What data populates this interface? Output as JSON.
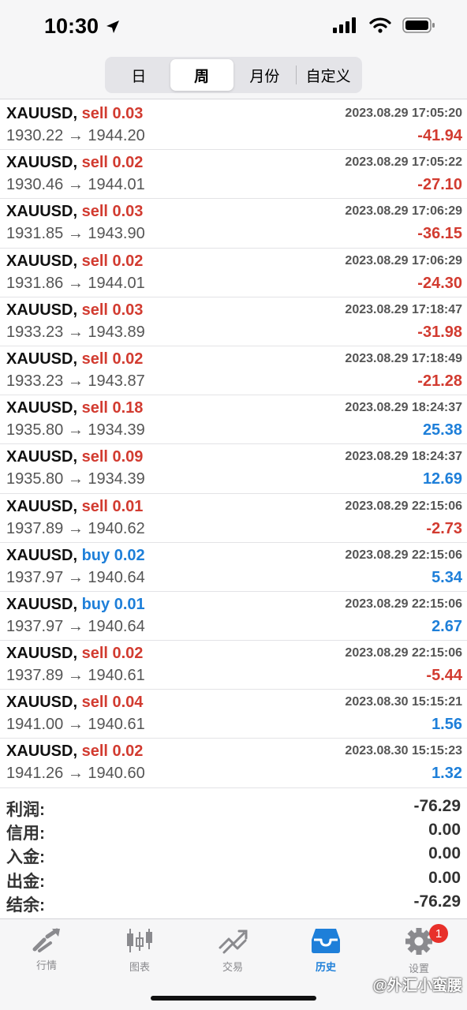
{
  "status_bar": {
    "time": "10:30",
    "icons": [
      "location-arrow-icon",
      "signal-icon",
      "wifi-icon",
      "battery-icon"
    ]
  },
  "segments": [
    {
      "label": "日",
      "active": false
    },
    {
      "label": "周",
      "active": true
    },
    {
      "label": "月份",
      "active": false
    },
    {
      "label": "自定义",
      "active": false
    }
  ],
  "trades": [
    {
      "symbol": "XAUUSD,",
      "side": "sell",
      "volume": "0.03",
      "datetime": "2023.08.29 17:05:20",
      "prices": "1930.22 → 1944.20",
      "profit": "-41.94",
      "sign": "neg"
    },
    {
      "symbol": "XAUUSD,",
      "side": "sell",
      "volume": "0.02",
      "datetime": "2023.08.29 17:05:22",
      "prices": "1930.46 → 1944.01",
      "profit": "-27.10",
      "sign": "neg"
    },
    {
      "symbol": "XAUUSD,",
      "side": "sell",
      "volume": "0.03",
      "datetime": "2023.08.29 17:06:29",
      "prices": "1931.85 → 1943.90",
      "profit": "-36.15",
      "sign": "neg"
    },
    {
      "symbol": "XAUUSD,",
      "side": "sell",
      "volume": "0.02",
      "datetime": "2023.08.29 17:06:29",
      "prices": "1931.86 → 1944.01",
      "profit": "-24.30",
      "sign": "neg"
    },
    {
      "symbol": "XAUUSD,",
      "side": "sell",
      "volume": "0.03",
      "datetime": "2023.08.29 17:18:47",
      "prices": "1933.23 → 1943.89",
      "profit": "-31.98",
      "sign": "neg"
    },
    {
      "symbol": "XAUUSD,",
      "side": "sell",
      "volume": "0.02",
      "datetime": "2023.08.29 17:18:49",
      "prices": "1933.23 → 1943.87",
      "profit": "-21.28",
      "sign": "neg"
    },
    {
      "symbol": "XAUUSD,",
      "side": "sell",
      "volume": "0.18",
      "datetime": "2023.08.29 18:24:37",
      "prices": "1935.80 → 1934.39",
      "profit": "25.38",
      "sign": "pos"
    },
    {
      "symbol": "XAUUSD,",
      "side": "sell",
      "volume": "0.09",
      "datetime": "2023.08.29 18:24:37",
      "prices": "1935.80 → 1934.39",
      "profit": "12.69",
      "sign": "pos"
    },
    {
      "symbol": "XAUUSD,",
      "side": "sell",
      "volume": "0.01",
      "datetime": "2023.08.29 22:15:06",
      "prices": "1937.89 → 1940.62",
      "profit": "-2.73",
      "sign": "neg"
    },
    {
      "symbol": "XAUUSD,",
      "side": "buy",
      "volume": "0.02",
      "datetime": "2023.08.29 22:15:06",
      "prices": "1937.97 → 1940.64",
      "profit": "5.34",
      "sign": "pos"
    },
    {
      "symbol": "XAUUSD,",
      "side": "buy",
      "volume": "0.01",
      "datetime": "2023.08.29 22:15:06",
      "prices": "1937.97 → 1940.64",
      "profit": "2.67",
      "sign": "pos"
    },
    {
      "symbol": "XAUUSD,",
      "side": "sell",
      "volume": "0.02",
      "datetime": "2023.08.29 22:15:06",
      "prices": "1937.89 → 1940.61",
      "profit": "-5.44",
      "sign": "neg"
    },
    {
      "symbol": "XAUUSD,",
      "side": "sell",
      "volume": "0.04",
      "datetime": "2023.08.30 15:15:21",
      "prices": "1941.00 → 1940.61",
      "profit": "1.56",
      "sign": "pos"
    },
    {
      "symbol": "XAUUSD,",
      "side": "sell",
      "volume": "0.02",
      "datetime": "2023.08.30 15:15:23",
      "prices": "1941.26 → 1940.60",
      "profit": "1.32",
      "sign": "pos"
    }
  ],
  "summary": [
    {
      "label": "利润:",
      "value": "-76.29"
    },
    {
      "label": "信用:",
      "value": "0.00"
    },
    {
      "label": "入金:",
      "value": "0.00"
    },
    {
      "label": "出金:",
      "value": "0.00"
    },
    {
      "label": "结余:",
      "value": "-76.29"
    }
  ],
  "tabs": [
    {
      "label": "行情",
      "icon": "quotes-arrows-icon",
      "active": false
    },
    {
      "label": "图表",
      "icon": "candlestick-chart-icon",
      "active": false
    },
    {
      "label": "交易",
      "icon": "trade-trend-icon",
      "active": false
    },
    {
      "label": "历史",
      "icon": "history-inbox-icon",
      "active": true
    },
    {
      "label": "设置",
      "icon": "settings-gear-icon",
      "active": false,
      "badge": "1"
    }
  ],
  "watermark": "@外汇小蛮腰",
  "colors": {
    "sell": "#d23b30",
    "buy": "#1e7fd9",
    "negative": "#d23b30",
    "positive": "#1e7fd9",
    "active_tab": "#1e7fd9",
    "badge": "#e8302a"
  }
}
